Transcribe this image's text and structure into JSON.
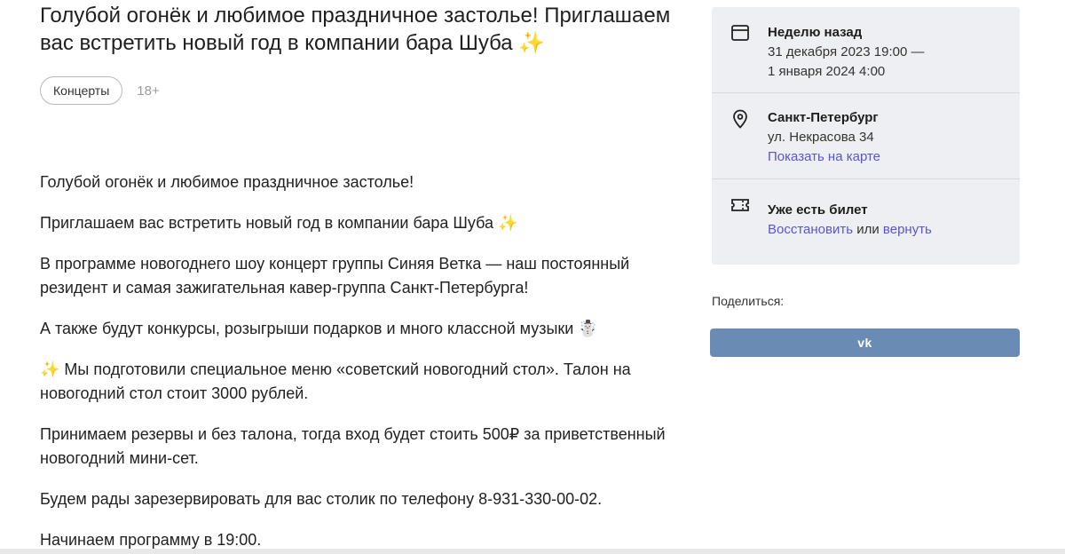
{
  "event": {
    "title": "Голубой огонёк и любимое праздничное застолье! Приглашаем вас встретить новый год в компании бара Шуба ✨",
    "tag": "Концерты",
    "age": "18+"
  },
  "description": [
    "Голубой огонёк и любимое праздничное застолье!",
    "Приглашаем вас встретить новый год в компании бара Шуба ✨",
    "В программе новогоднего шоу концерт группы Синяя Ветка — наш постоянный резидент и самая зажигательная кавер-группа Санкт-Петербурга!",
    "А также будут конкурсы, розыгрыши подарков и много классной музыки ☃️",
    "✨ Мы подготовили специальное меню «советский новогодний стол». Талон на новогодний стол стоит 3000 рублей.",
    "Принимаем резервы и без талона, тогда вход будет стоить 500₽ за приветственный новогодний мини-сет.",
    "Будем рады зарезервировать для вас столик по телефону 8-931-330-00-02.",
    "Начинаем программу в 19:00."
  ],
  "info": {
    "date": {
      "icon": "calendar-icon",
      "title": "Неделю назад",
      "line1": "31 декабря 2023 19:00 —",
      "line2": "1 января 2024 4:00"
    },
    "place": {
      "icon": "location-pin-icon",
      "city": "Санкт-Петербург",
      "address": "ул. Некрасова 34",
      "map_link": "Показать на карте"
    },
    "ticket": {
      "icon": "ticket-icon",
      "title": "Уже есть билет",
      "restore_link": "Восстановить",
      "or": " или ",
      "return_link": "вернуть"
    }
  },
  "share": {
    "label": "Поделиться:",
    "vk_label": "vk"
  },
  "colors": {
    "link": "#5a54d6",
    "vk": "#6a8bb3",
    "card_bg": "#eeeff3"
  }
}
